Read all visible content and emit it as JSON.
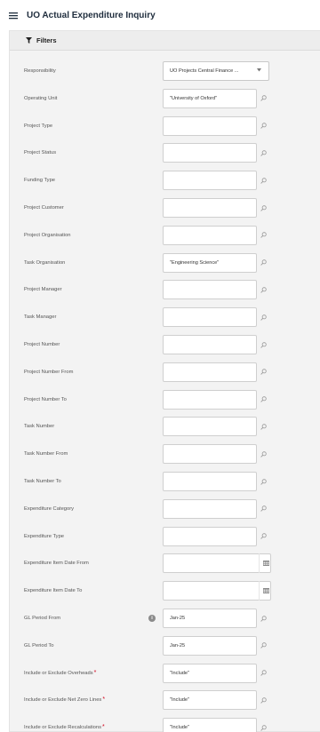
{
  "header": {
    "title": "UO Actual Expenditure Inquiry"
  },
  "filters": {
    "label": "Filters",
    "fields": [
      {
        "label": "Responsibility",
        "value": "UO Projects Central Finance ...",
        "kind": "select"
      },
      {
        "label": "Operating Unit",
        "value": "\"University of Oxford\"",
        "kind": "lov"
      },
      {
        "label": "Project Type",
        "value": "",
        "kind": "lov"
      },
      {
        "label": "Project Status",
        "value": "",
        "kind": "lov"
      },
      {
        "label": "Funding Type",
        "value": "",
        "kind": "lov"
      },
      {
        "label": "Project Customer",
        "value": "",
        "kind": "lov"
      },
      {
        "label": "Project Organisation",
        "value": "",
        "kind": "lov"
      },
      {
        "label": "Task Organisation",
        "value": "\"Engineering Science\"",
        "kind": "lov"
      },
      {
        "label": "Project Manager",
        "value": "",
        "kind": "lov"
      },
      {
        "label": "Task Manager",
        "value": "",
        "kind": "lov"
      },
      {
        "label": "Project Number",
        "value": "",
        "kind": "lov"
      },
      {
        "label": "Project Number From",
        "value": "",
        "kind": "lov"
      },
      {
        "label": "Project Number To",
        "value": "",
        "kind": "lov"
      },
      {
        "label": "Task Number",
        "value": "",
        "kind": "lov"
      },
      {
        "label": "Task Number From",
        "value": "",
        "kind": "lov"
      },
      {
        "label": "Task Number To",
        "value": "",
        "kind": "lov"
      },
      {
        "label": "Expenditure Category",
        "value": "",
        "kind": "lov"
      },
      {
        "label": "Expenditure Type",
        "value": "",
        "kind": "lov"
      },
      {
        "label": "Expenditure Item Date From",
        "value": "",
        "kind": "date"
      },
      {
        "label": "Expenditure Item Date To",
        "value": "",
        "kind": "date"
      },
      {
        "label": "GL Period From",
        "value": "Jan-25",
        "kind": "lov",
        "info": true
      },
      {
        "label": "GL Period To",
        "value": "Jan-25",
        "kind": "lov"
      },
      {
        "label": "Include or Exclude Overheads",
        "value": "\"Include\"",
        "kind": "lov",
        "required": true
      },
      {
        "label": "Include or Exclude Net Zero Lines",
        "value": "\"Include\"",
        "kind": "lov",
        "required": true
      },
      {
        "label": "Include or Exclude Recalculations",
        "value": "\"Include\"",
        "kind": "lov",
        "required": true
      }
    ]
  },
  "colors": {
    "required": "#d0021b",
    "panel_bg": "#f3f3f3",
    "field_border": "#cfcfcf"
  },
  "icons": {
    "menu": "menu-icon",
    "filter": "filter-icon",
    "search": "search-icon",
    "calendar": "calendar-icon",
    "info": "info-icon",
    "dropdown": "chevron-down-icon"
  }
}
